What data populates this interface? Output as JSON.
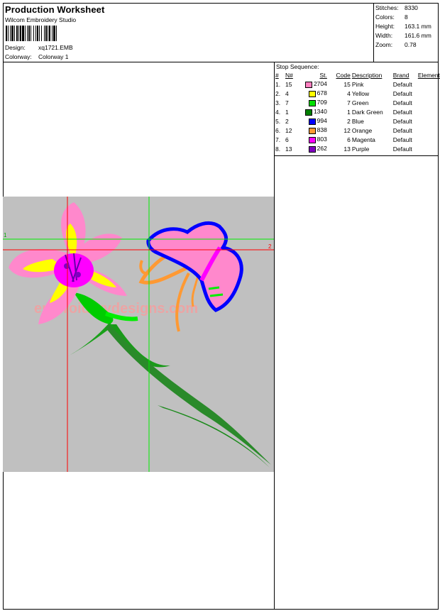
{
  "header": {
    "title": "Production Worksheet",
    "software": "Wilcom  Embroidery Studio",
    "design_label": "Design:",
    "design_value": "xq1721.EMB",
    "colorway_label": "Colorway:",
    "colorway_value": "Colorway 1"
  },
  "stats": [
    {
      "label": "Stitches:",
      "value": "8330"
    },
    {
      "label": "Colors:",
      "value": "8"
    },
    {
      "label": "Height:",
      "value": "163.1 mm"
    },
    {
      "label": "Width:",
      "value": "161.6 mm"
    },
    {
      "label": "Zoom:",
      "value": "0.78"
    }
  ],
  "stop_sequence": {
    "title": "Stop Sequence:",
    "headers": [
      "#",
      "N#",
      "St.",
      "Code",
      "Description",
      "Brand",
      "Element"
    ],
    "rows": [
      {
        "num": "1.",
        "n": "15",
        "color": "#ff80c0",
        "st": "2704",
        "code": "15",
        "desc": "Pink",
        "brand": "Default"
      },
      {
        "num": "2.",
        "n": "4",
        "color": "#ffff00",
        "st": "678",
        "code": "4",
        "desc": "Yellow",
        "brand": "Default"
      },
      {
        "num": "3.",
        "n": "7",
        "color": "#00e000",
        "st": "709",
        "code": "7",
        "desc": "Green",
        "brand": "Default"
      },
      {
        "num": "4.",
        "n": "1",
        "color": "#008000",
        "st": "1340",
        "code": "1",
        "desc": "Dark Green",
        "brand": "Default"
      },
      {
        "num": "5.",
        "n": "2",
        "color": "#0000ff",
        "st": "994",
        "code": "2",
        "desc": "Blue",
        "brand": "Default"
      },
      {
        "num": "6.",
        "n": "12",
        "color": "#ff9933",
        "st": "838",
        "code": "12",
        "desc": "Orange",
        "brand": "Default"
      },
      {
        "num": "7.",
        "n": "6",
        "color": "#ff00ff",
        "st": "803",
        "code": "6",
        "desc": "Magenta",
        "brand": "Default"
      },
      {
        "num": "8.",
        "n": "13",
        "color": "#8000c0",
        "st": "262",
        "code": "13",
        "desc": "Purple",
        "brand": "Default"
      }
    ]
  },
  "design": {
    "watermark": "embroiderydesigns.com",
    "marker_left": "1",
    "marker_right": "2",
    "background": "#c0c0c0"
  }
}
